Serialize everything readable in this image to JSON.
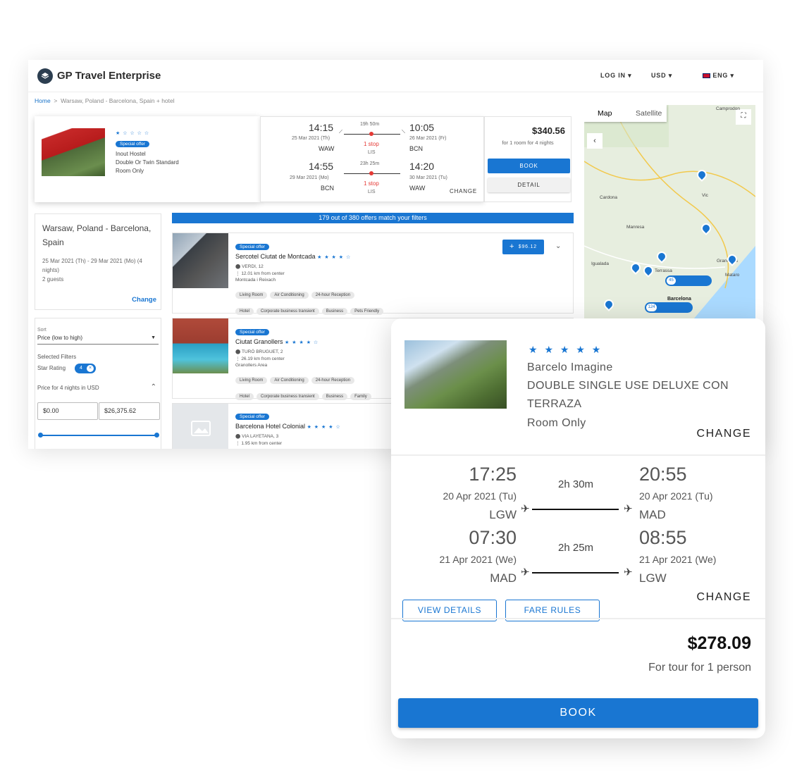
{
  "header": {
    "brand": "GP Travel Enterprise",
    "login": "LOG IN",
    "currency": "USD",
    "language": "ENG"
  },
  "breadcrumb": {
    "home": "Home",
    "sep": ">",
    "current": "Warsaw, Poland - Barcelona, Spain + hotel"
  },
  "top_offer": {
    "stars": "★ ☆ ☆ ☆ ☆",
    "badge": "Special offer",
    "hotel": "Inout Hostel",
    "room": "Double Or Twin Standard",
    "board": "Room Only",
    "out": {
      "dep_time": "14:15",
      "dep_date": "25 Mar 2021 (Th)",
      "dep_code": "WAW",
      "duration": "19h 50m",
      "stops": "1 stop",
      "via": "LIS",
      "arr_time": "10:05",
      "arr_date": "26 Mar 2021 (Fr)",
      "arr_code": "BCN"
    },
    "ret": {
      "dep_time": "14:55",
      "dep_date": "29 Mar 2021 (Mo)",
      "dep_code": "BCN",
      "duration": "23h 25m",
      "stops": "1 stop",
      "via": "LIS",
      "arr_time": "14:20",
      "arr_date": "30 Mar 2021 (Tu)",
      "arr_code": "WAW"
    },
    "change": "CHANGE",
    "price": "$340.56",
    "price_note": "for 1 room for 4 nights",
    "book": "BOOK",
    "detail": "DETAIL"
  },
  "search_box": {
    "title": "Warsaw, Poland - Barcelona, Spain",
    "dates": "25 Mar 2021 (Th) - 29 Mar 2021 (Mo) (4 nights)",
    "guests": "2 guests",
    "change": "Change"
  },
  "filters": {
    "sort_label": "Sort",
    "sort_value": "Price (low to high)",
    "selected": "Selected Filters",
    "star_rating": "Star Rating",
    "star_chip": "4",
    "price_label": "Price for 4 nights in USD",
    "min": "$0.00",
    "max": "$26,375.62"
  },
  "results_bar": "179 out of 380 offers match your filters",
  "hotels": [
    {
      "badge": "Special offer",
      "name": "Sercotel Ciutat de Montcada",
      "stars": "★ ★ ★ ★ ☆",
      "address": "VERDI, 12",
      "distance": "12.01 km from center",
      "area": "Montcada i Reixach",
      "tags1": [
        "Living Room",
        "Air Conditioning",
        "24-hour Reception"
      ],
      "tags2": [
        "Hotel",
        "Corporate business transient",
        "Business",
        "Pets Friendly"
      ],
      "price": "$96.12"
    },
    {
      "badge": "Special offer",
      "name": "Ciutat Granollers",
      "stars": "★ ★ ★ ★ ☆",
      "address": "TURÓ BRUGUET, 2",
      "distance": "26.19 km from center",
      "area": "Granollers Area",
      "tags1": [
        "Living Room",
        "Air Conditioning",
        "24-hour Reception"
      ],
      "tags2": [
        "Hotel",
        "Corporate business transient",
        "Business",
        "Family"
      ]
    },
    {
      "badge": "Special offer",
      "name": "Barcelona Hotel Colonial",
      "stars": "★ ★ ★ ★ ☆",
      "address": "VIA LAYETANA, 3",
      "distance": "1.95 km from center"
    }
  ],
  "map": {
    "tab_map": "Map",
    "tab_sat": "Satellite",
    "labels": [
      "Camprodon",
      "Igualada",
      "Terrassa",
      "Mataro",
      "Manresa",
      "Vic",
      "Barcelona",
      "Granollers",
      "Cardona"
    ],
    "cluster1": "45",
    "cluster2": "124"
  },
  "detail": {
    "stars": "★ ★ ★ ★ ★",
    "hotel": "Barcelo Imagine",
    "room_line1": "DOUBLE SINGLE USE DELUXE CON",
    "room_line2": "TERRAZA",
    "board": "Room Only",
    "change1": "CHANGE",
    "out": {
      "dep_time": "17:25",
      "dep_date": "20 Apr 2021 (Tu)",
      "dep_code": "LGW",
      "duration": "2h 30m",
      "arr_time": "20:55",
      "arr_date": "20 Apr 2021 (Tu)",
      "arr_code": "MAD"
    },
    "ret": {
      "dep_time": "07:30",
      "dep_date": "21 Apr 2021 (We)",
      "dep_code": "MAD",
      "duration": "2h 25m",
      "arr_time": "08:55",
      "arr_date": "21 Apr 2021 (We)",
      "arr_code": "LGW"
    },
    "change2": "CHANGE",
    "view_details": "VIEW DETAILS",
    "fare_rules": "FARE RULES",
    "price": "$278.09",
    "price_note": "For tour for 1 person",
    "book": "BOOK"
  },
  "colors": {
    "accent": "#1976d2",
    "stop_red": "#e53935"
  }
}
